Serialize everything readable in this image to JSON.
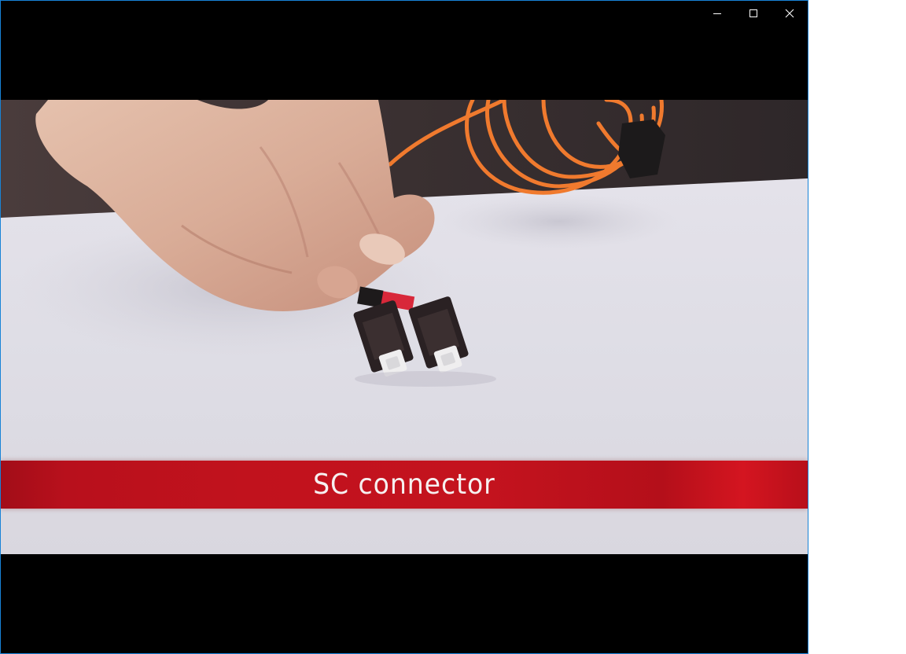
{
  "window": {
    "controls": {
      "minimize_icon": "minimize-icon",
      "maximize_icon": "maximize-icon",
      "close_icon": "close-icon"
    },
    "border_color": "#1883d7"
  },
  "video": {
    "caption": "SC connector",
    "caption_band_color": "#c1121d"
  }
}
